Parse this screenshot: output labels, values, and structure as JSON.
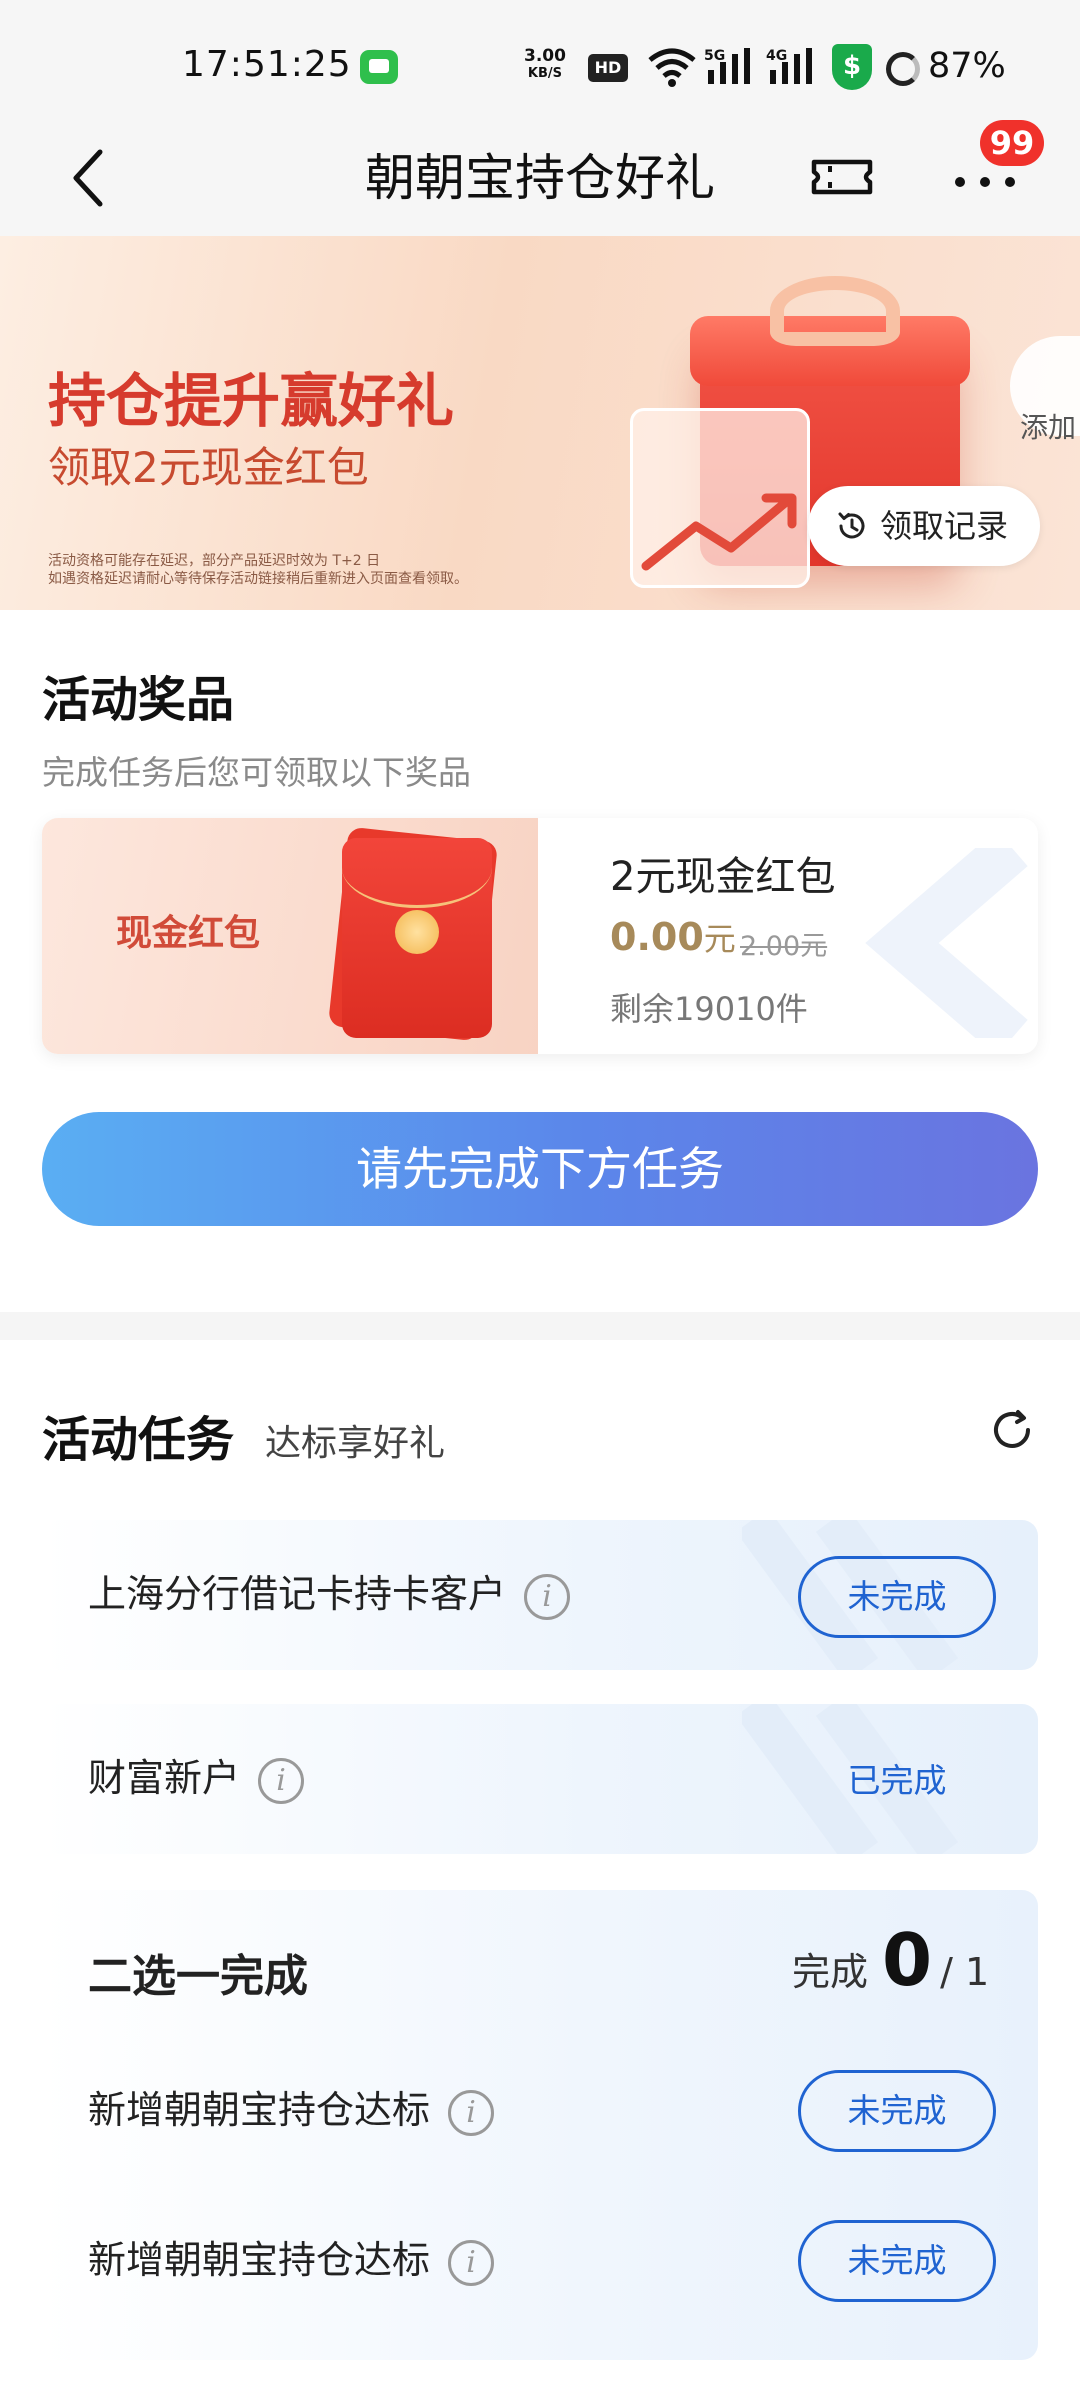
{
  "status_bar": {
    "time": "17:51:25",
    "speed_value": "3.00",
    "speed_unit": "KB/S",
    "hd_label": "HD",
    "signal_5g": "5G",
    "signal_4g": "4G",
    "shield_symbol": "$",
    "battery": "87%"
  },
  "nav": {
    "title": "朝朝宝持仓好礼",
    "badge": "99"
  },
  "banner": {
    "title": "持仓提升赢好礼",
    "subtitle": "领取2元现金红包",
    "note_line1": "活动资格可能存在延迟，部分产品延迟时效为 T+2 日",
    "note_line2": "如遇资格延迟请耐心等待保存活动链接稍后重新进入页面查看领取。",
    "side_label": "添加",
    "record_label": "领取记录"
  },
  "prize_section": {
    "title": "活动奖品",
    "subtitle": "完成任务后您可领取以下奖品",
    "card": {
      "left_label": "现金红包",
      "name": "2元现金红包",
      "price": "0.00",
      "price_unit": "元",
      "original_price": "2.00元",
      "remaining": "剩余19010件"
    },
    "main_button": "请先完成下方任务"
  },
  "task_section": {
    "title": "活动任务",
    "subtitle": "达标享好礼",
    "info_symbol": "i",
    "tasks": [
      {
        "label": "上海分行借记卡持卡客户",
        "status": "未完成"
      },
      {
        "label": "财富新户",
        "status": "已完成"
      }
    ],
    "choose": {
      "title": "二选一完成",
      "progress_label": "完成",
      "progress_done": "0",
      "progress_total": "/ 1",
      "items": [
        {
          "label": "新增朝朝宝持仓达标",
          "status": "未完成"
        },
        {
          "label": "新增朝朝宝持仓达标",
          "status": "未完成"
        }
      ]
    }
  },
  "colors": {
    "accent_blue": "#1f63d1",
    "banner_red": "#d63b2d",
    "badge_red": "#f0312b",
    "price_gold": "#a78a5a"
  },
  "icons": [
    "back-icon",
    "ticket-icon",
    "more-icon",
    "history-icon",
    "refresh-icon",
    "info-icon",
    "wifi-icon",
    "signal-icon",
    "shield-icon"
  ]
}
